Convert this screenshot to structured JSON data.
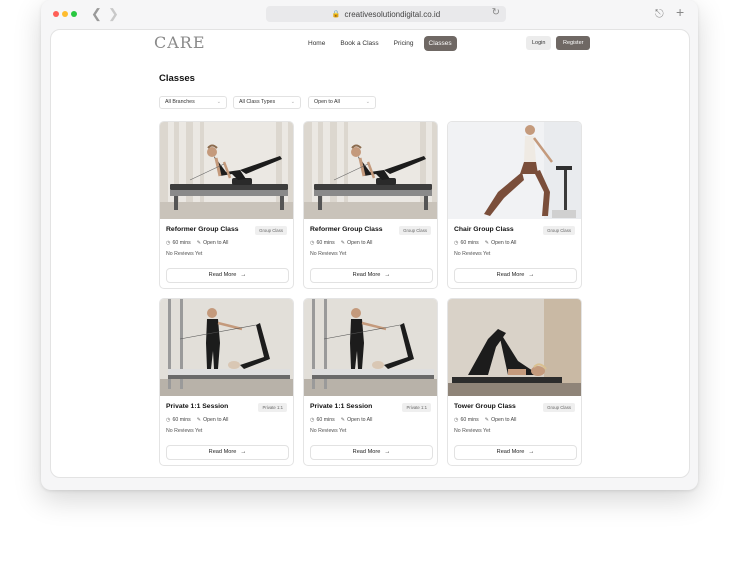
{
  "browser": {
    "url": "creativesolutiondigital.co.id"
  },
  "site": {
    "logo": "CARE",
    "nav": [
      {
        "label": "Home",
        "active": false
      },
      {
        "label": "Book a Class",
        "active": false
      },
      {
        "label": "Pricing",
        "active": false
      },
      {
        "label": "Classes",
        "active": true
      }
    ],
    "login_label": "Login",
    "register_label": "Register"
  },
  "main": {
    "title": "Classes",
    "filters": [
      {
        "label": "All Branches"
      },
      {
        "label": "All Class Types"
      },
      {
        "label": "Open to All"
      }
    ],
    "cards": [
      {
        "title": "Reformer Group Class",
        "badge": "Group Class",
        "duration": "60 mins",
        "level": "Open to All",
        "reviews": "No Reviews Yet",
        "button": "Read More",
        "photo": "reformer-kneeling"
      },
      {
        "title": "Reformer Group Class",
        "badge": "Group Class",
        "duration": "60 mins",
        "level": "Open to All",
        "reviews": "No Reviews Yet",
        "button": "Read More",
        "photo": "reformer-kneeling"
      },
      {
        "title": "Chair Group Class",
        "badge": "Group Class",
        "duration": "60 mins",
        "level": "Open to All",
        "reviews": "No Reviews Yet",
        "button": "Read More",
        "photo": "chair-lunge"
      },
      {
        "title": "Private 1:1 Session",
        "badge": "Private 1:1",
        "duration": "60 mins",
        "level": "Open to All",
        "reviews": "No Reviews Yet",
        "button": "Read More",
        "photo": "private-instructor"
      },
      {
        "title": "Private 1:1 Session",
        "badge": "Private 1:1",
        "duration": "60 mins",
        "level": "Open to All",
        "reviews": "No Reviews Yet",
        "button": "Read More",
        "photo": "private-instructor"
      },
      {
        "title": "Tower Group Class",
        "badge": "Group Class",
        "duration": "60 mins",
        "level": "Open to All",
        "reviews": "No Reviews Yet",
        "button": "Read More",
        "photo": "tower-bridge"
      }
    ]
  },
  "colors": {
    "accent": "#6f6864",
    "page_bg": "#ffffff",
    "window_bg": "#f6f6f7"
  }
}
